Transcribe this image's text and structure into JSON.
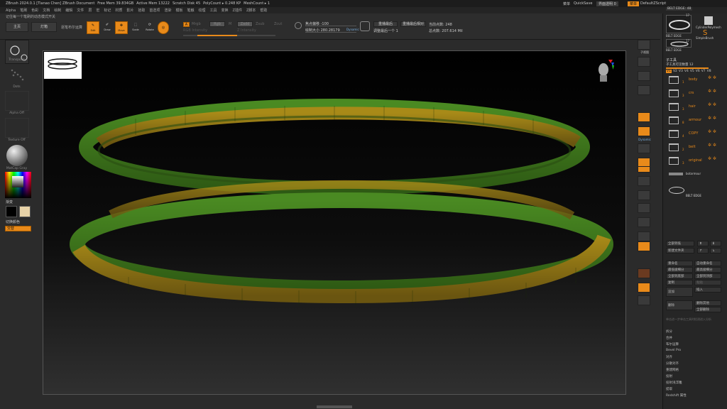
{
  "title": {
    "app": "ZBrush 2024.0.1 [Tianao Chen]   ZBrush Document",
    "free_mem": "Free Mem 39.834GB",
    "active_mem": "Active Mem 13222",
    "scratch": "Scratch Disk 45",
    "polycount": "PolyCount ▸ 0.248 KP",
    "meshcount": "MeshCount ▸ 1",
    "menu_label": "菜单",
    "quicksave": "QuickSave",
    "transparency": "界面透明 0",
    "layout_btn": "菜单",
    "default_script": "DefaultZScript"
  },
  "menu": [
    "Alpha",
    "笔刷",
    "色彩",
    "文档",
    "绘制",
    "编辑",
    "文件",
    "层",
    "宏",
    "标记",
    "材质",
    "影片",
    "拾取",
    "首选项",
    "渲染",
    "模板",
    "笔触",
    "纹理",
    "工具",
    "变换",
    "Z插件",
    "Z脚本",
    "帮助"
  ],
  "toolbar": {
    "hint": "记住每一个笔刷的动态模式开关",
    "home": "主页",
    "lightbox": "灯箱",
    "live_boolean": "逐笔布尔运算",
    "edit": "Edit",
    "draw": "Draw",
    "move": "Move",
    "scale": "Scale",
    "rotate": "Rotate",
    "a_btn": "A",
    "mrgb": "Mrgb",
    "rgb": "Rgb",
    "m": "M",
    "zadd": "Zadd",
    "zsub": "Zsub",
    "zcut": "Zcut",
    "rgb_intensity": "RGB Intensity",
    "z_intensity": "Z Intensity",
    "focal_shift": "焦点偏移 -100",
    "draw_size": "绘制大小 280.28179",
    "dynamic": "Dynamic",
    "replay_last": "重播最后",
    "replay_last_rel": "重播最后相对",
    "adjust_last": "调整最后一个 1",
    "active_points": "当前点数: 248",
    "total_points": "总点数: 207.614 Mil"
  },
  "left": {
    "transpose": "Transpose",
    "dots": "Dots",
    "alpha_off": "Alpha Off",
    "texture_off": "Texture Off",
    "material": "MatCap Gray",
    "gradient": "渐变",
    "switch_color": "切换颜色",
    "alternate": "交替"
  },
  "right_tools": [
    "子视图",
    "滚动",
    "缩放",
    "实际",
    "AAHalf",
    "透视",
    "地面",
    "局部",
    "L.Sym",
    "Gxyz",
    "帧",
    "移动",
    "缩放",
    "旋转",
    "线框",
    "透明",
    "Dynamic",
    "Solo"
  ],
  "panel": {
    "top_label": "BELT EDGE: 48",
    "tool_a": "BELT EDGE",
    "tool_b": "CylinderPolymesh",
    "tool_c": "SimpleBrush",
    "tool_d": "BELT EDGE",
    "count_a": "17",
    "count_b": "17",
    "subtool_title": "子工具",
    "subtool_count": "子工具可见数量 12",
    "visibility": [
      "V1",
      "V2",
      "V3",
      "V4",
      "V5",
      "V6",
      "V7",
      "V8"
    ],
    "subtools": [
      {
        "name": "body",
        "num": "1"
      },
      {
        "name": "crs",
        "num": "3"
      },
      {
        "name": "hair",
        "num": "3"
      },
      {
        "name": "armour",
        "num": "8"
      },
      {
        "name": "COPY",
        "num": "4"
      },
      {
        "name": "belt",
        "num": "2"
      },
      {
        "name": "original",
        "num": "3"
      }
    ],
    "bot_armour": "botarmour",
    "belt_edge": "BELT EDGE",
    "all_low": "全部到低",
    "all_high": "全部到高",
    "new_folder": "新建文件夹",
    "rename": "重命名",
    "auto_rename": "自动重命名",
    "all_low2": "最低级细分",
    "all_high2": "最高级细分",
    "copy_all_low": "全部到底部",
    "copy_all_high": "全部到顶部",
    "duplicate": "复制",
    "paste": "粘贴",
    "append": "追加",
    "insert": "插入",
    "delete": "删除",
    "delete_other": "删除其他",
    "delete_all": "全部删除",
    "hint": "单击进一步单击工具时检测进入分析",
    "split": "拆分",
    "merge": "合并",
    "boolean": "布尔运算",
    "bevel_pro": "Bevel Pro",
    "align": "对齐",
    "distribute": "分散对齐",
    "remesh": "重建网格",
    "project": "投射",
    "project_bas": "投射浅浮雕",
    "extract": "提取",
    "redshift": "Redshift 属性"
  },
  "colors": {
    "accent": "#e88a1a",
    "ring_green": "#3f7a1c",
    "ring_gold": "#9c7f15"
  }
}
